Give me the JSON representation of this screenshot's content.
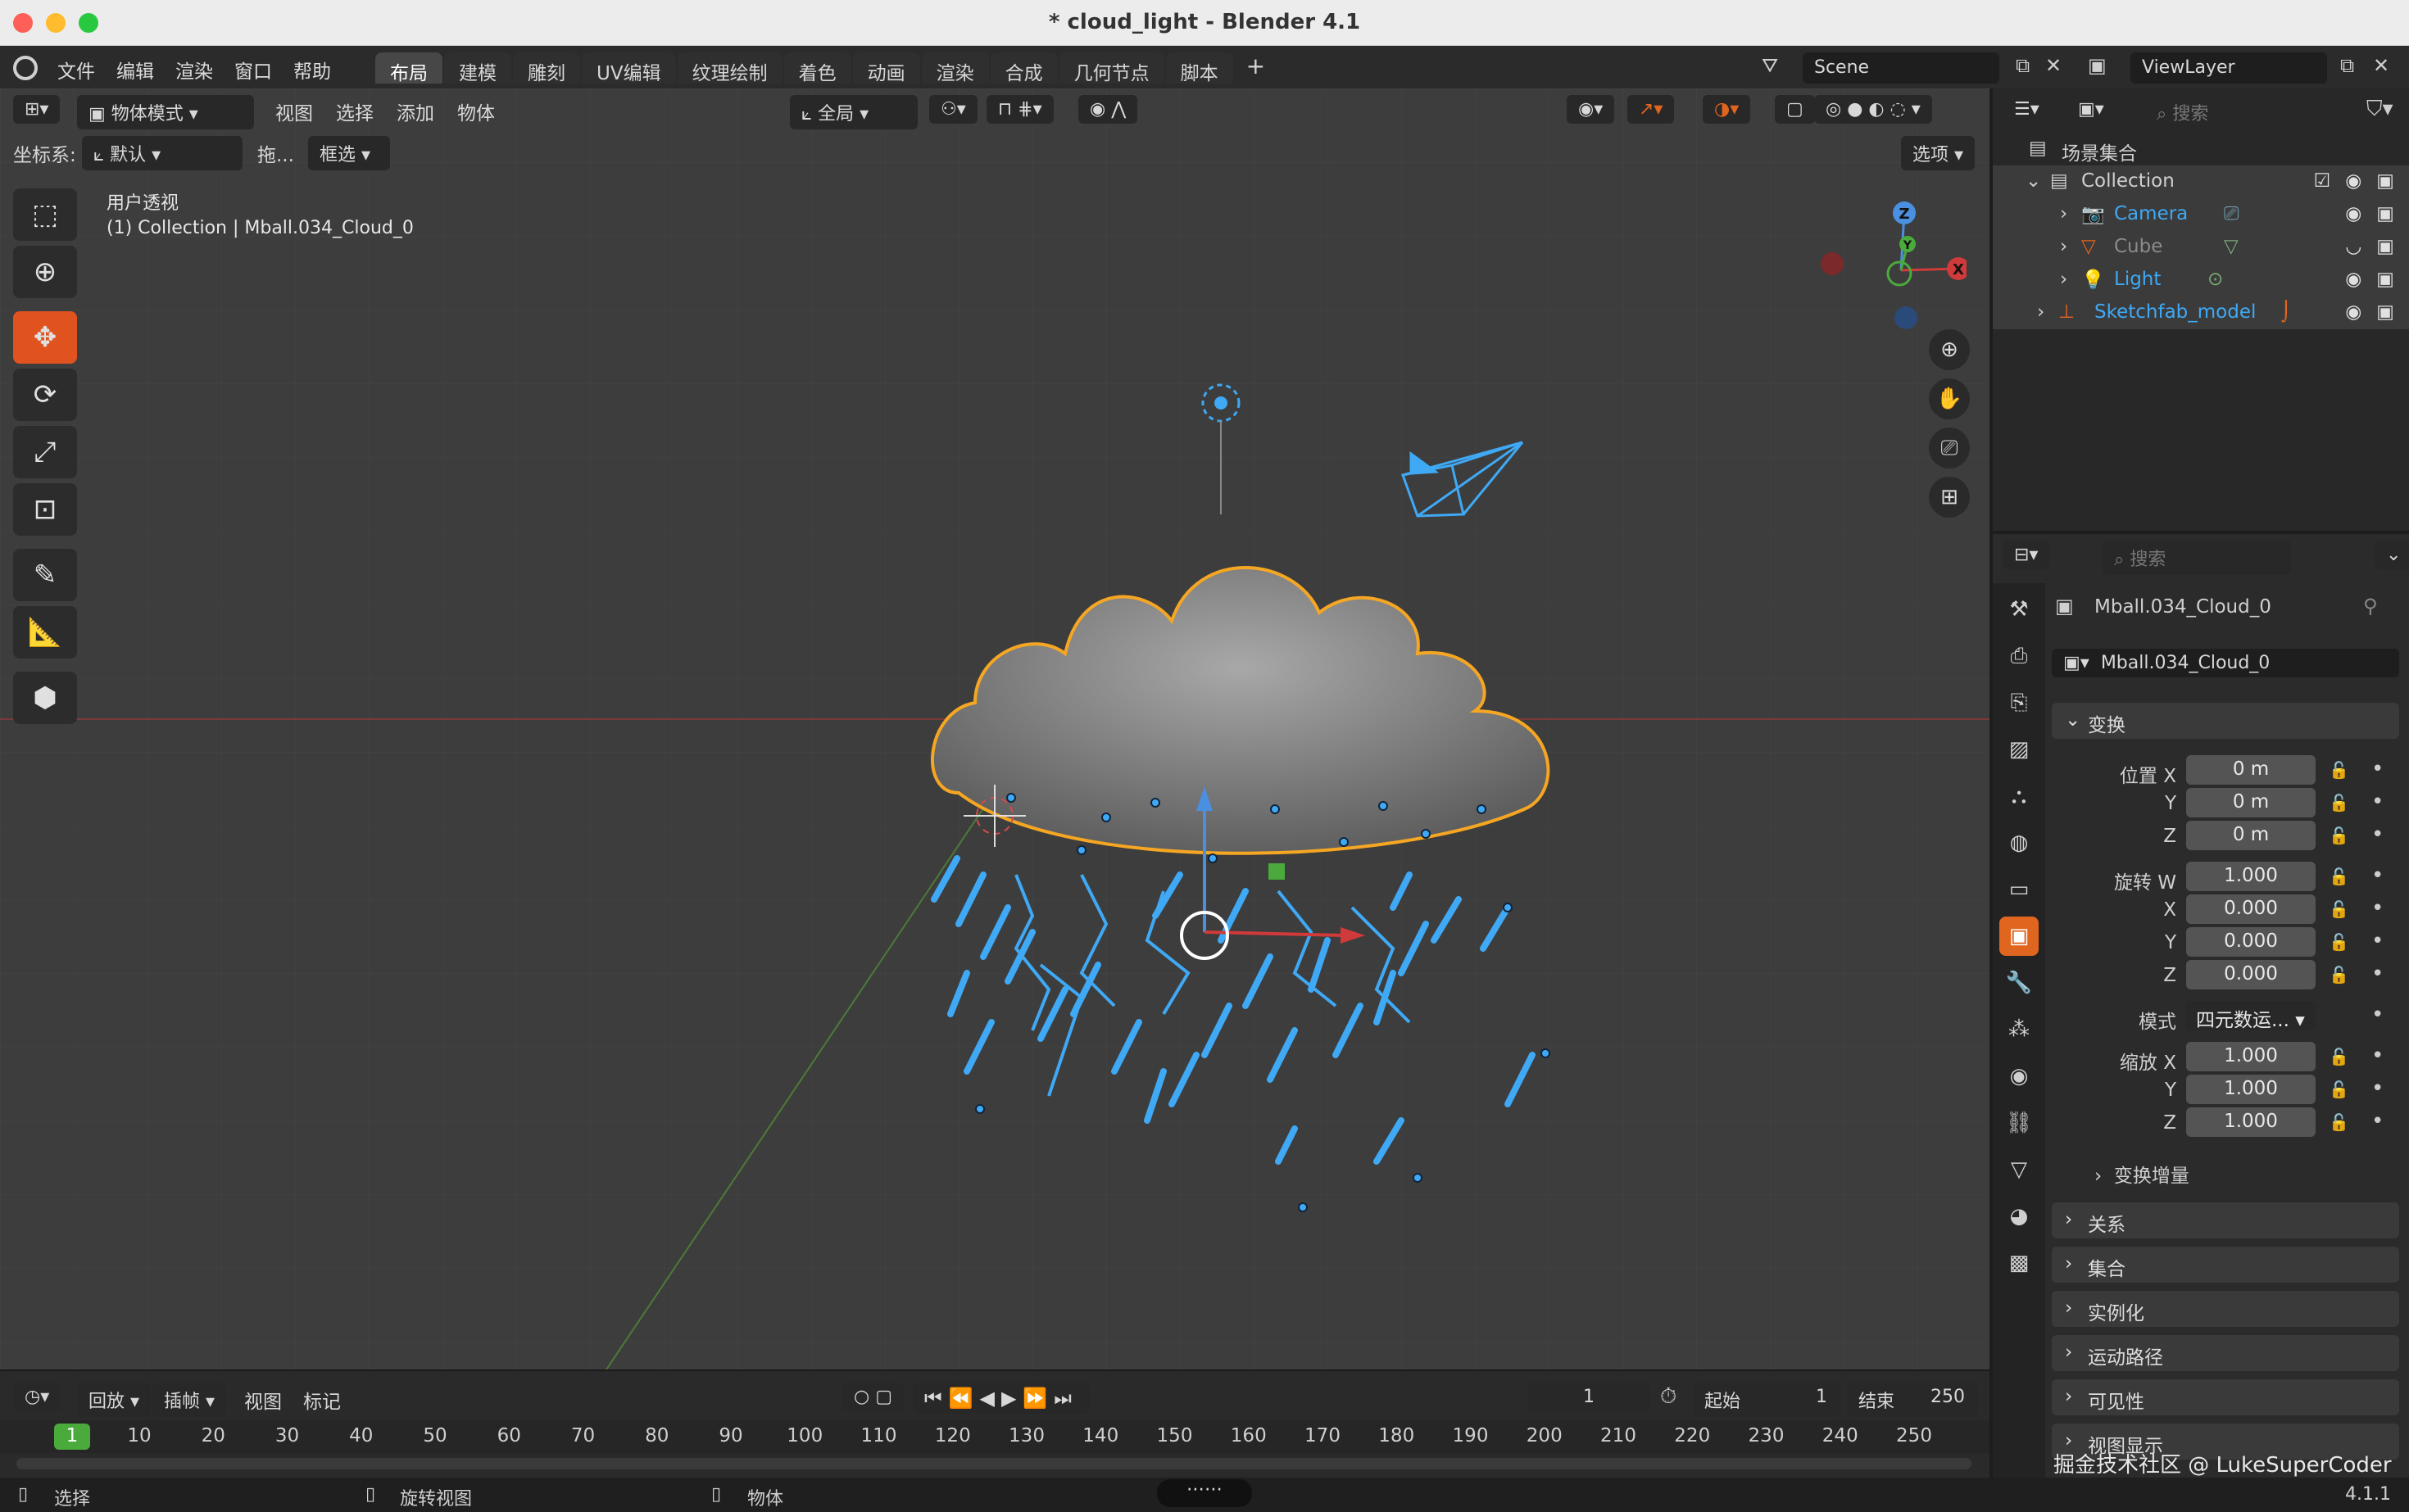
{
  "window": {
    "title": "* cloud_light - Blender 4.1"
  },
  "menu": [
    "文件",
    "编辑",
    "渲染",
    "窗口",
    "帮助"
  ],
  "workspaces": [
    {
      "label": "布局",
      "active": true
    },
    {
      "label": "建模"
    },
    {
      "label": "雕刻"
    },
    {
      "label": "UV编辑"
    },
    {
      "label": "纹理绘制"
    },
    {
      "label": "着色"
    },
    {
      "label": "动画"
    },
    {
      "label": "渲染"
    },
    {
      "label": "合成"
    },
    {
      "label": "几何节点"
    },
    {
      "label": "脚本"
    }
  ],
  "scene": {
    "name": "Scene",
    "view_layer": "ViewLayer"
  },
  "viewport_header": {
    "mode": "物体模式",
    "menus": [
      "视图",
      "选择",
      "添加",
      "物体"
    ],
    "transform_orientation": "全局",
    "coord_label": "坐标系:",
    "coord_value": "默认",
    "drag_label": "拖...",
    "select_mode": "框选",
    "options": "选项"
  },
  "viewport_overlay": {
    "view_name": "用户透视",
    "context": "(1) Collection | Mball.034_Cloud_0"
  },
  "gizmo": {
    "x": "X",
    "y": "Y",
    "z": "Z"
  },
  "timeline": {
    "playback": "回放",
    "keying": "插帧",
    "view": "视图",
    "marker": "标记",
    "current_frame": "1",
    "start_label": "起始",
    "start": "1",
    "end_label": "结束",
    "end": "250",
    "ruler_ticks": [
      "10",
      "20",
      "30",
      "40",
      "50",
      "60",
      "70",
      "80",
      "90",
      "100",
      "110",
      "120",
      "130",
      "140",
      "150",
      "160",
      "170",
      "180",
      "190",
      "200",
      "210",
      "220",
      "230",
      "240",
      "250"
    ],
    "ruler_current": "1"
  },
  "status": {
    "select": "选择",
    "rotate": "旋转视图",
    "object": "物体",
    "version": "4.1.1"
  },
  "outliner": {
    "search_placeholder": "搜索",
    "root": "场景集合",
    "collection": "Collection",
    "items": [
      {
        "name": "Camera",
        "color": "#3fa9f5"
      },
      {
        "name": "Cube",
        "color": "#8a8a8a"
      },
      {
        "name": "Light",
        "color": "#3fa9f5"
      }
    ],
    "sketchfab": "Sketchfab_model"
  },
  "properties": {
    "search_placeholder": "搜索",
    "object_name": "Mball.034_Cloud_0",
    "object_field": "Mball.034_Cloud_0",
    "transform_header": "变换",
    "location": {
      "label": "位置 X",
      "x": "0 m",
      "y": "0 m",
      "z": "0 m"
    },
    "rotation": {
      "label": "旋转 W",
      "w": "1.000",
      "x": "0.000",
      "y": "0.000",
      "z": "0.000"
    },
    "mode_label": "模式",
    "mode_value": "四元数运...",
    "scale": {
      "label": "缩放 X",
      "x": "1.000",
      "y": "1.000",
      "z": "1.000"
    },
    "axis_y": "Y",
    "axis_z": "Z",
    "axis_x": "X",
    "delta": "变换增量",
    "panels": [
      "关系",
      "集合",
      "实例化",
      "运动路径",
      "可见性",
      "视图显示"
    ]
  },
  "watermark": "掘金技术社区 @ LukeSuperCoder",
  "colors": {
    "accent": "#e0651e",
    "selection": "#3fa9f5",
    "outline": "#f5a623",
    "current_frame": "#4aaa3c"
  }
}
